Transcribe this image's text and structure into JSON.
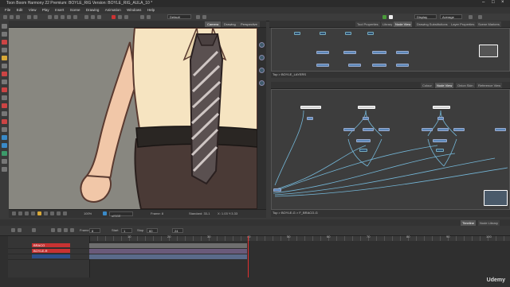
{
  "window": {
    "title": "Toon Boom Harmony 22 Premium: BOYLE_RIG Version: BOYLE_RIG_AULA_10 *"
  },
  "menu": [
    "File",
    "Edit",
    "View",
    "Play",
    "Insert",
    "Scene",
    "Drawing",
    "Animation",
    "Windows",
    "Help"
  ],
  "toolbar": {
    "workspace_combo": "Default",
    "display_combo": "Display",
    "average_combo": "Average"
  },
  "camera_view": {
    "tabs": [
      "Camera",
      "Drawing",
      "Perspective"
    ],
    "active_tab": "Camera",
    "zoom": "100%",
    "drawing_combo": "ulSGE",
    "frame_label": "Frame: 8",
    "status_center": "Standard: 33-1",
    "coords": "X: 1.03 Y:3.33"
  },
  "node_panel_top": {
    "tabs": [
      "Tool Properties",
      "Library",
      "Node View",
      "Drawing Substitutions",
      "Layer Properties",
      "Scene Markers"
    ],
    "active_tab": "Node View",
    "breadcrumb": "Top > BOYLE_LAYERS"
  },
  "node_panel_bottom": {
    "tabs": [
      "Colour",
      "Node View",
      "Onion Skin",
      "Reference View"
    ],
    "active_tab": "Node View",
    "breadcrumb": "Top > BOYLE-G > F_BRACO-G"
  },
  "timeline": {
    "tabs": [
      "Timeline",
      "Node Library"
    ],
    "frame_label": "Frame",
    "frame_value": "8",
    "start_label": "Start",
    "start_value": "1",
    "stop_label": "Stop",
    "stop_value": "60",
    "fps_value": "24",
    "layers": [
      {
        "name": "BRACO"
      },
      {
        "name": "BOYLE-R"
      },
      {
        "name": ""
      }
    ],
    "ruler_marks": [
      "10",
      "20",
      "30",
      "40",
      "50",
      "60",
      "70",
      "80",
      "90",
      "100"
    ]
  },
  "watermark": "Udemy",
  "colors": {
    "accent": "#e03030",
    "node_blue": "#5a86b8",
    "skin": "#f1c7a8",
    "shirt": "#f6e4c1",
    "pants": "#4a3a36",
    "belt": "#2a2623",
    "background": "#888780"
  }
}
